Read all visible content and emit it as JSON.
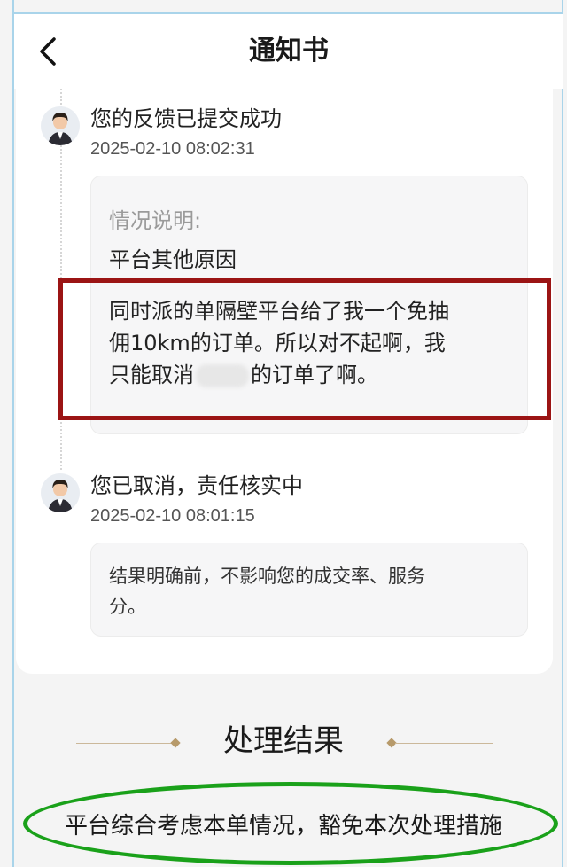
{
  "header": {
    "title": "通知书",
    "back_icon": "chevron-left-icon"
  },
  "timeline": [
    {
      "title": "您的反馈已提交成功",
      "time": "2025-02-10 08:02:31",
      "bubble": {
        "label": "情况说明:",
        "reason": "平台其他原因",
        "detail_line1": "同时派的单隔壁平台给了我一个免抽",
        "detail_line2": "佣10km的订单。所以对不起啊，我",
        "detail_line3_prefix": "只能取消",
        "detail_line3_suffix": "的订单了啊。"
      }
    },
    {
      "title": "您已取消，责任核实中",
      "time": "2025-02-10 08:01:15",
      "bubble": {
        "text_line1": "结果明确前，不影响您的成交率、服务",
        "text_line2": "分。"
      }
    }
  ],
  "result": {
    "title": "处理结果",
    "text": "平台综合考虑本单情况，豁免本次处理措施"
  },
  "colors": {
    "annotation_red": "#9b1414",
    "annotation_green": "#1aa11a",
    "decor_gold": "#b79a6a"
  }
}
